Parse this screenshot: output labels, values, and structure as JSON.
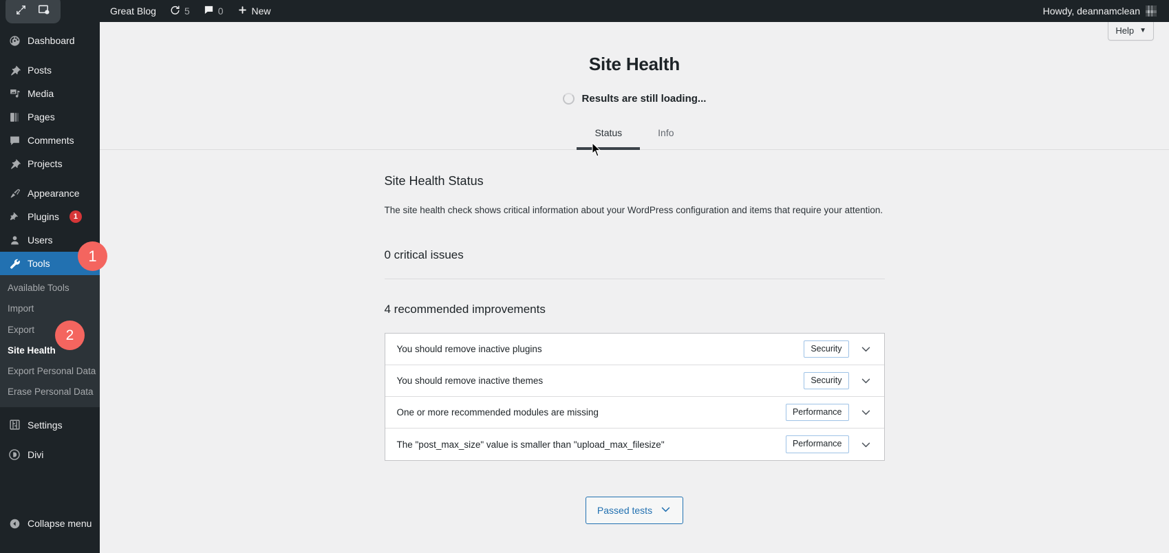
{
  "adminbar": {
    "extension_icons": [
      "resize-arrows-icon",
      "screenshot-icon"
    ],
    "site_name": "Great Blog",
    "updates": {
      "icon": "updates-icon",
      "count": "5"
    },
    "comments": {
      "icon": "comment-bubble-icon",
      "count": "0"
    },
    "new": {
      "icon": "plus-icon",
      "label": "New"
    },
    "howdy": "Howdy, deannamclean"
  },
  "sidebar": {
    "items": [
      {
        "label": "Dashboard",
        "icon": "dashboard-icon",
        "current": false
      },
      {
        "label": "Posts",
        "icon": "pin-icon",
        "current": false
      },
      {
        "label": "Media",
        "icon": "media-icon",
        "current": false
      },
      {
        "label": "Pages",
        "icon": "pages-icon",
        "current": false
      },
      {
        "label": "Comments",
        "icon": "comment-icon",
        "current": false
      },
      {
        "label": "Projects",
        "icon": "pin-icon",
        "current": false
      },
      {
        "label": "Appearance",
        "icon": "brush-icon",
        "current": false
      },
      {
        "label": "Plugins",
        "icon": "plugin-icon",
        "current": false,
        "badge": "1"
      },
      {
        "label": "Users",
        "icon": "user-icon",
        "current": false
      },
      {
        "label": "Tools",
        "icon": "wrench-icon",
        "current": true
      },
      {
        "label": "Settings",
        "icon": "settings-icon",
        "current": false
      },
      {
        "label": "Divi",
        "icon": "divi-icon",
        "current": false
      }
    ],
    "tools_submenu": [
      {
        "label": "Available Tools",
        "current": false
      },
      {
        "label": "Import",
        "current": false
      },
      {
        "label": "Export",
        "current": false
      },
      {
        "label": "Site Health",
        "current": true
      },
      {
        "label": "Export Personal Data",
        "current": false
      },
      {
        "label": "Erase Personal Data",
        "current": false
      }
    ],
    "collapse": {
      "label": "Collapse menu",
      "icon": "collapse-arrow-icon"
    }
  },
  "annotations": [
    {
      "id": "1",
      "label": "1"
    },
    {
      "id": "2",
      "label": "2"
    }
  ],
  "help": {
    "label": "Help",
    "caret": "▼"
  },
  "page": {
    "title": "Site Health",
    "loading_text": "Results are still loading...",
    "tabs": [
      {
        "label": "Status",
        "active": true
      },
      {
        "label": "Info",
        "active": false
      }
    ],
    "section_title": "Site Health Status",
    "section_desc": "The site health check shows critical information about your WordPress configuration and items that require your attention.",
    "critical_heading": "0 critical issues",
    "recommended_heading": "4 recommended improvements",
    "issues": [
      {
        "title": "You should remove inactive plugins",
        "badge": "Security",
        "chevron": "chevron-down-icon"
      },
      {
        "title": "You should remove inactive themes",
        "badge": "Security",
        "chevron": "chevron-down-icon"
      },
      {
        "title": "One or more recommended modules are missing",
        "badge": "Performance",
        "chevron": "chevron-down-icon"
      },
      {
        "title": "The \"post_max_size\" value is smaller than \"upload_max_filesize\"",
        "badge": "Performance",
        "chevron": "chevron-down-icon"
      }
    ],
    "passed_tests_label": "Passed tests"
  },
  "colors": {
    "admin_dark": "#1d2327",
    "submenu_bg": "#2c3338",
    "accent_blue": "#2271b1",
    "badge_red": "#d63638",
    "annotation_red": "#f4655f",
    "page_bg": "#f0f0f1"
  }
}
